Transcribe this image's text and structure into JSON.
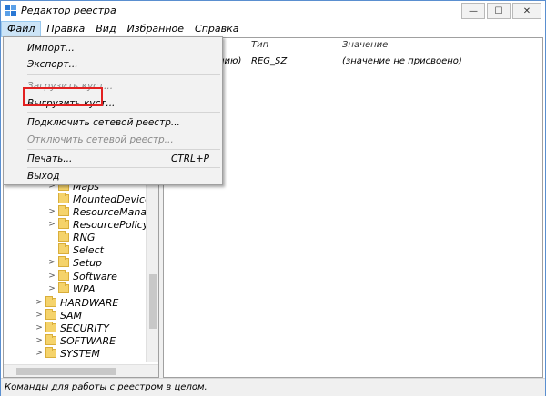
{
  "window": {
    "title": "Редактор реестра",
    "controls": {
      "minimize": "—",
      "maximize": "☐",
      "close": "✕"
    }
  },
  "menubar": {
    "items": [
      "Файл",
      "Правка",
      "Вид",
      "Избранное",
      "Справка"
    ]
  },
  "file_menu": {
    "items": [
      {
        "label": "Импорт...",
        "disabled": false
      },
      {
        "label": "Экспорт...",
        "disabled": false
      },
      {
        "label": "Загрузить куст...",
        "disabled": true
      },
      {
        "label": "Выгрузить куст...",
        "disabled": false,
        "highlighted": true
      },
      {
        "label": "Подключить сетевой реестр...",
        "disabled": false
      },
      {
        "label": "Отключить сетевой реестр...",
        "disabled": true
      },
      {
        "label": "Печать...",
        "shortcut": "CTRL+P",
        "disabled": false
      },
      {
        "label": "Выход",
        "disabled": false
      }
    ]
  },
  "tree": {
    "items": [
      "Maps",
      "MountedDevices",
      "ResourceManager",
      "ResourcePolicyStor",
      "RNG",
      "Select",
      "Setup",
      "Software",
      "WPA",
      "HARDWARE",
      "SAM",
      "SECURITY",
      "SOFTWARE",
      "SYSTEM"
    ]
  },
  "list": {
    "columns": {
      "name": "",
      "type": "Тип",
      "value": "Значение"
    },
    "rows": [
      {
        "name_partial": "нию)",
        "type": "REG_SZ",
        "value": "(значение не присвоено)"
      }
    ]
  },
  "statusbar": {
    "text": "Команды для работы с реестром в целом."
  },
  "colors": {
    "highlight_border": "#e32121",
    "menu_active_bg": "#cce4f7",
    "folder": "#f5d36b"
  }
}
